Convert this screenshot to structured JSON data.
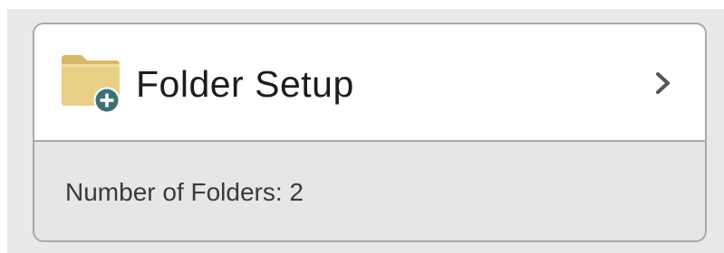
{
  "folder_setup": {
    "title": "Folder Setup",
    "icon": "folder-add-icon",
    "chevron_icon": "chevron-right-icon",
    "count_label": "Number of Folders: ",
    "count_value": "2"
  },
  "colors": {
    "folder": "#e9cf85",
    "badge": "#3e6f76",
    "border": "#a9a9a9",
    "info_background": "#e6e6e6"
  }
}
